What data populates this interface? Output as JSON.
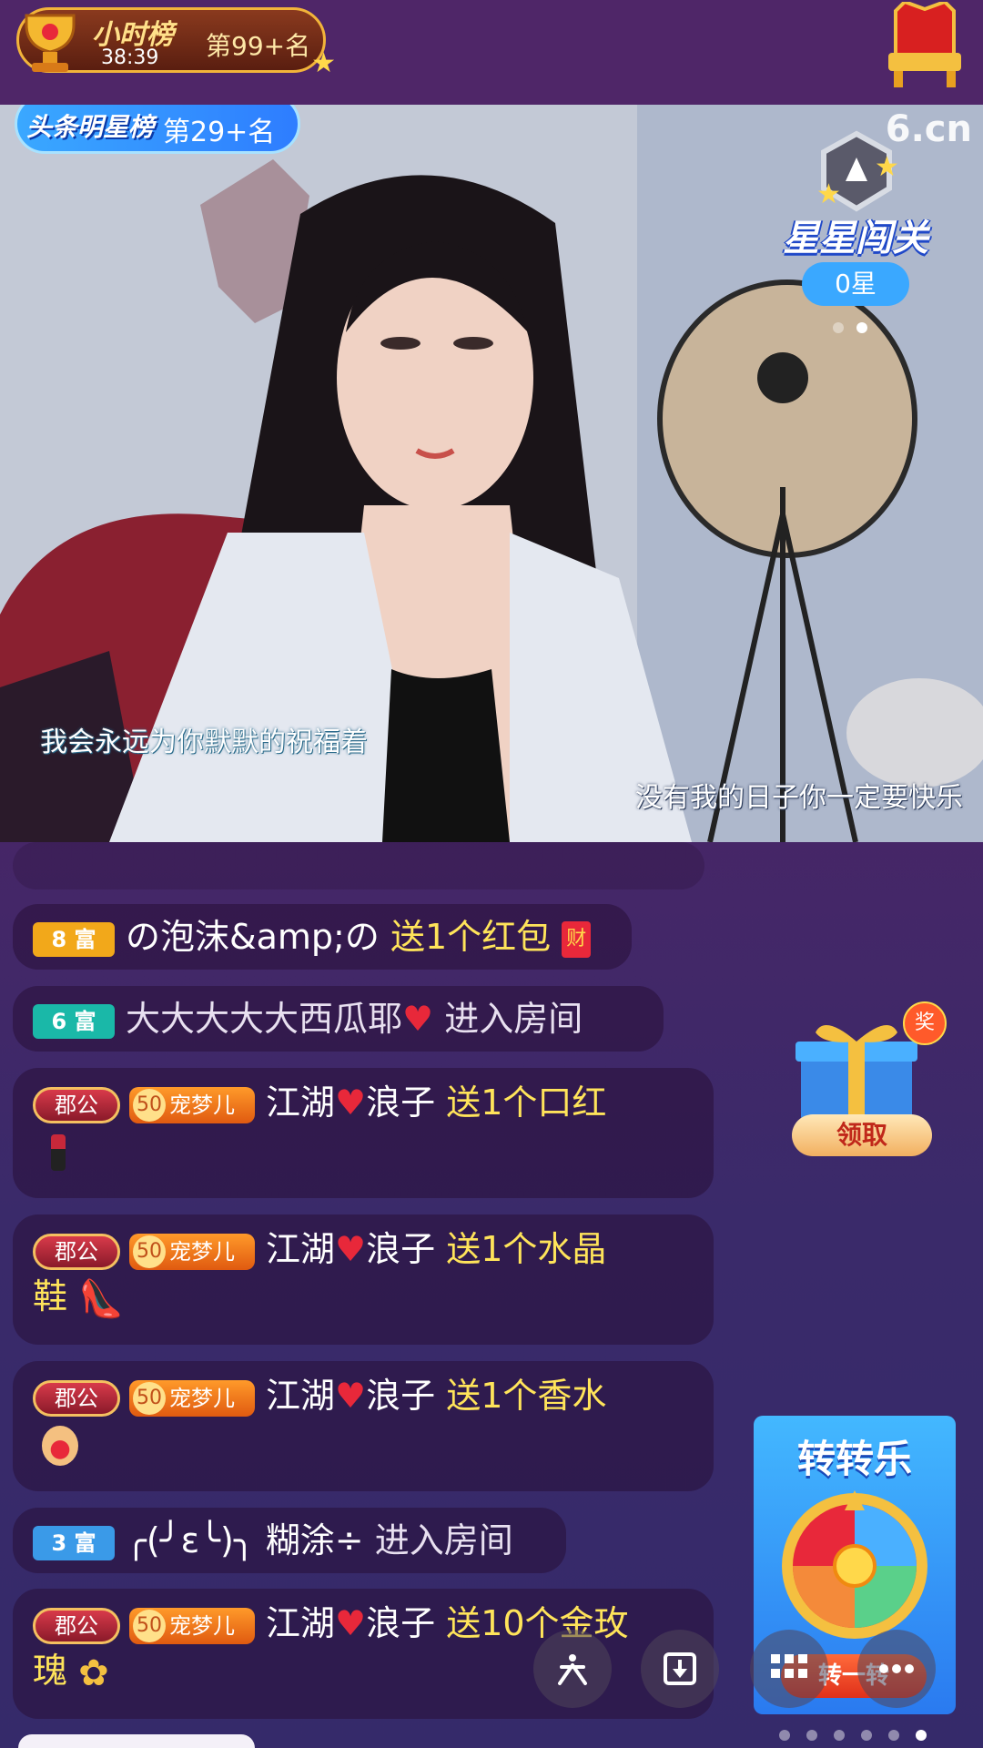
{
  "hour_rank": {
    "title": "小时榜",
    "time": "38:39",
    "rank": "第99+名"
  },
  "headline_rank": {
    "label": "头条明星榜",
    "rank": "第29+名"
  },
  "logo": "6.cn",
  "star_pass": {
    "title": "星星闯关",
    "count": "0星"
  },
  "lyrics": {
    "line1": "我会永远为你默默的祝福着",
    "line2": "没有我的日子你一定要快乐"
  },
  "chat": [
    {
      "level": "8",
      "level_label": "富",
      "level_color": "#f2a81a",
      "user": "の泡沫&amp;の",
      "action": "送1个红包",
      "gift": "red-packet-icon"
    },
    {
      "level": "6",
      "level_label": "富",
      "level_color": "#1ab8a8",
      "user": "大大大大大西瓜耶",
      "action": "进入房间"
    },
    {
      "title_badge": "郡公",
      "pet_badge": "宠梦儿",
      "pet_level": "50",
      "user_a": "江湖",
      "user_b": "浪子",
      "action": "送1个口红",
      "gift": "lipstick-icon"
    },
    {
      "title_badge": "郡公",
      "pet_badge": "宠梦儿",
      "pet_level": "50",
      "user_a": "江湖",
      "user_b": "浪子",
      "action": "送1个水晶",
      "action_cont": "鞋",
      "gift": "crystal-shoe-icon"
    },
    {
      "title_badge": "郡公",
      "pet_badge": "宠梦儿",
      "pet_level": "50",
      "user_a": "江湖",
      "user_b": "浪子",
      "action": "送1个香水",
      "gift": "perfume-icon"
    },
    {
      "level": "3",
      "level_label": "富",
      "level_color": "#3a9ae8",
      "user": "╭(╯ε╰)╮ 糊涂÷",
      "action": "进入房间"
    },
    {
      "title_badge": "郡公",
      "pet_badge": "宠梦儿",
      "pet_level": "50",
      "user_a": "江湖",
      "user_b": "浪子",
      "action": "送10个金玫",
      "action_cont": "瑰",
      "gift": "gold-rose-icon"
    }
  ],
  "reward": {
    "tag": "奖",
    "label": "领取"
  },
  "lucky_wheel": {
    "title": "转转乐",
    "button": "转一转"
  },
  "colors": {
    "accent_yellow": "#ffe45a",
    "bg_purple": "#4f2668",
    "heart": "#e8283a"
  }
}
